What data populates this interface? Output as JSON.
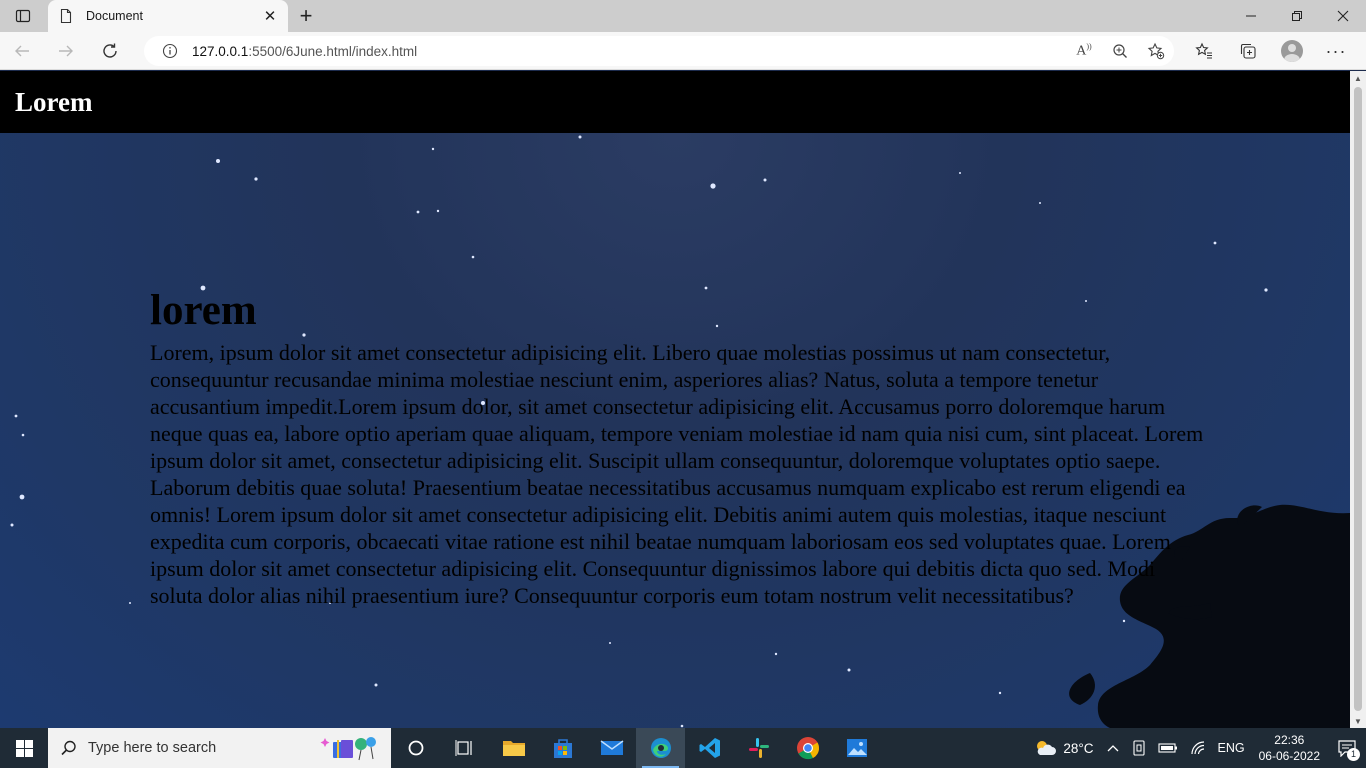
{
  "browser": {
    "tab_title": "Document",
    "url_host": "127.0.0.1",
    "url_path": ":5500/6June.html/index.html"
  },
  "page": {
    "brand": "Lorem",
    "heading": "lorem",
    "paragraph": "Lorem, ipsum dolor sit amet consectetur adipisicing elit. Libero quae molestias possimus ut nam consectetur, consequuntur recusandae minima molestiae nesciunt enim, asperiores alias? Natus, soluta a tempore tenetur accusantium impedit.Lorem ipsum dolor, sit amet consectetur adipisicing elit. Accusamus porro doloremque harum neque quas ea, labore optio aperiam quae aliquam, tempore veniam molestiae id nam quia nisi cum, sint placeat. Lorem ipsum dolor sit amet, consectetur adipisicing elit. Suscipit ullam consequuntur, doloremque voluptates optio saepe. Laborum debitis quae soluta! Praesentium beatae necessitatibus accusamus numquam explicabo est rerum eligendi ea omnis! Lorem ipsum dolor sit amet consectetur adipisicing elit. Debitis animi autem quis molestias, itaque nesciunt expedita cum corporis, obcaecati vitae ratione est nihil beatae numquam laboriosam eos sed voluptates quae. Lorem ipsum dolor sit amet consectetur adipisicing elit. Consequuntur dignissimos labore qui debitis dicta quo sed. Modi soluta dolor alias nihil praesentium iure? Consequuntur corporis eum totam nostrum velit necessitatibus?"
  },
  "taskbar": {
    "search_placeholder": "Type here to search",
    "weather": "28°C",
    "language": "ENG",
    "time": "22:36",
    "date": "06-06-2022",
    "notification_count": "1"
  },
  "colors": {
    "navbar": "#000000",
    "night_sky": "#22345a",
    "taskbar": "#1f2b36"
  }
}
